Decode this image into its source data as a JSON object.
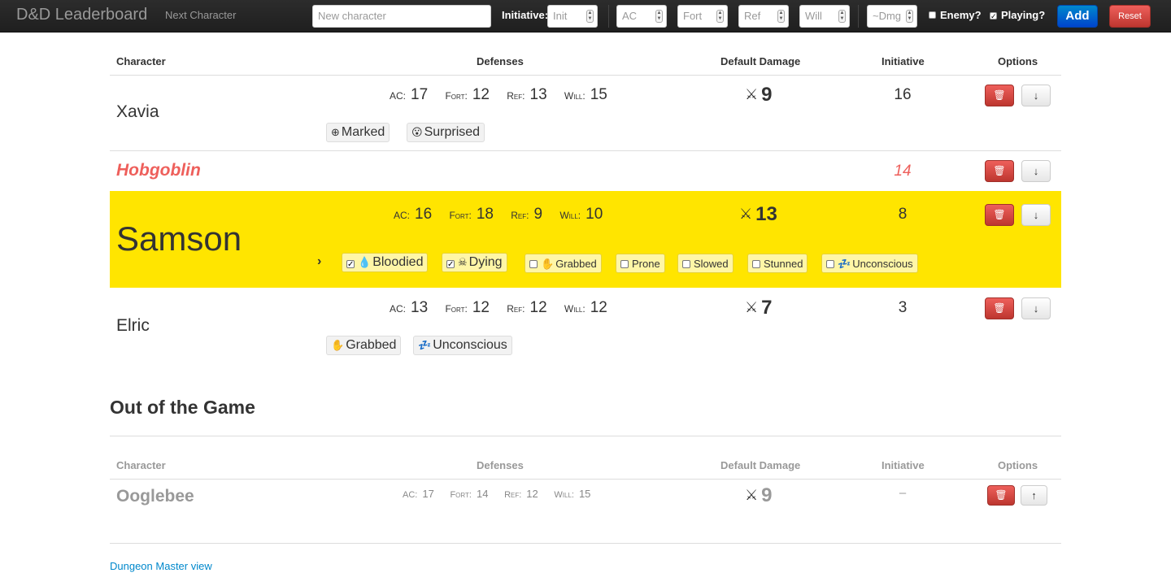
{
  "navbar": {
    "brand": "D&D Leaderboard",
    "next_character": "Next Character",
    "new_character_placeholder": "New character",
    "initiative_label": "Initiative:",
    "init_placeholder": "Init",
    "ac_placeholder": "AC",
    "fort_placeholder": "Fort",
    "ref_placeholder": "Ref",
    "will_placeholder": "Will",
    "dmg_placeholder": "~Dmg",
    "enemy_label": "Enemy?",
    "enemy_checked": false,
    "playing_label": "Playing?",
    "playing_checked": true,
    "add_label": "Add",
    "reset_label": "Reset"
  },
  "table": {
    "headers": [
      "Character",
      "Defenses",
      "Default Damage",
      "Initiative",
      "Options"
    ],
    "def_labels": [
      "AC:",
      "Fort:",
      "Ref:",
      "Will:"
    ],
    "rows": [
      {
        "name": "Xavia",
        "ac": "17",
        "fort": "12",
        "ref": "13",
        "will": "15",
        "damage": "9",
        "initiative": "16",
        "conditions": [
          "Marked",
          "Surprised"
        ]
      },
      {
        "name": "Hobgoblin",
        "enemy": true,
        "initiative": "14"
      },
      {
        "name": "Samson",
        "active": true,
        "ac": "16",
        "fort": "18",
        "ref": "9",
        "will": "10",
        "damage": "13",
        "initiative": "8",
        "condition_options": [
          {
            "label": "Bloodied",
            "checked": true
          },
          {
            "label": "Dying",
            "checked": true
          },
          {
            "label": "Grabbed",
            "checked": false
          },
          {
            "label": "Prone",
            "checked": false
          },
          {
            "label": "Slowed",
            "checked": false
          },
          {
            "label": "Stunned",
            "checked": false
          },
          {
            "label": "Unconscious",
            "checked": false
          }
        ]
      },
      {
        "name": "Elric",
        "ac": "13",
        "fort": "12",
        "ref": "12",
        "will": "12",
        "damage": "7",
        "initiative": "3",
        "conditions": [
          "Grabbed",
          "Unconscious"
        ]
      }
    ]
  },
  "out_of_game": {
    "title": "Out of the Game",
    "headers": [
      "Character",
      "Defenses",
      "Default Damage",
      "Initiative",
      "Options"
    ],
    "rows": [
      {
        "name": "Ooglebee",
        "ac": "17",
        "fort": "14",
        "ref": "12",
        "will": "15",
        "damage": "9",
        "initiative": "–"
      }
    ]
  },
  "footer_link": "Dungeon Master view",
  "colors": {
    "highlight": "#ffe500",
    "enemy": "#ee5f5b",
    "link": "#0088cc"
  }
}
